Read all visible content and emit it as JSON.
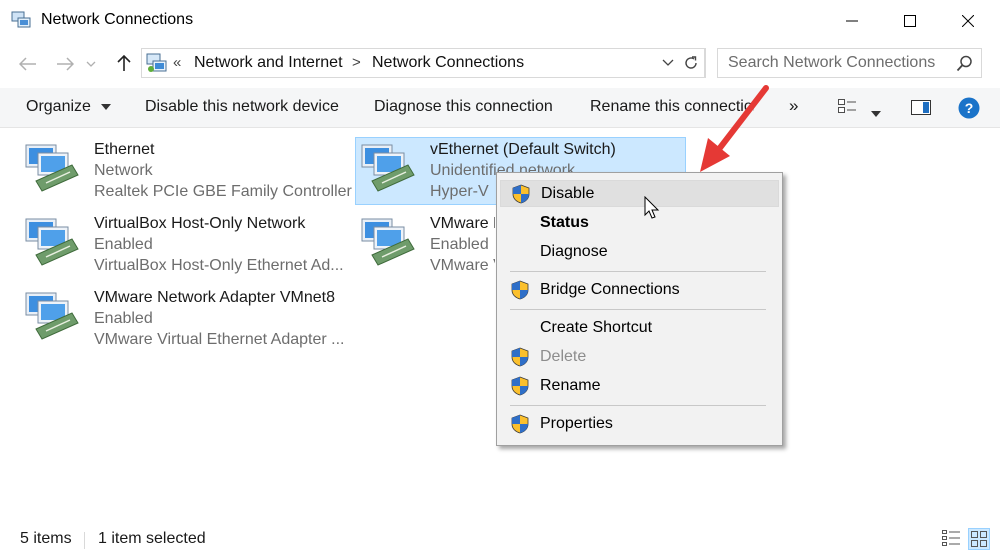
{
  "window": {
    "title": "Network Connections"
  },
  "address": {
    "overflow": "«",
    "crumbs": [
      "Network and Internet",
      "Network Connections"
    ],
    "separator": ">"
  },
  "search": {
    "placeholder": "Search Network Connections"
  },
  "toolbar": {
    "organize": "Organize",
    "disable": "Disable this network device",
    "diagnose": "Diagnose this connection",
    "rename": "Rename this connection",
    "more": "»"
  },
  "items": [
    {
      "name": "Ethernet",
      "status": "Network",
      "device": "Realtek PCIe GBE Family Controller"
    },
    {
      "name": "VirtualBox Host-Only Network",
      "status": "Enabled",
      "device": "VirtualBox Host-Only Ethernet Ad..."
    },
    {
      "name": "VMware Network Adapter VMnet8",
      "status": "Enabled",
      "device": "VMware Virtual Ethernet Adapter ..."
    },
    {
      "name": "vEthernet (Default Switch)",
      "status": "Unidentified network",
      "device": "Hyper-V"
    },
    {
      "name": "VMware N",
      "status": "Enabled",
      "device": "VMware V"
    }
  ],
  "context_menu": {
    "items": [
      {
        "label": "Disable",
        "shield": true
      },
      {
        "label": "Status",
        "shield": false
      },
      {
        "label": "Diagnose",
        "shield": false
      },
      {
        "label": "Bridge Connections",
        "shield": true
      },
      {
        "label": "Create Shortcut",
        "shield": false
      },
      {
        "label": "Delete",
        "shield": true
      },
      {
        "label": "Rename",
        "shield": true
      },
      {
        "label": "Properties",
        "shield": true
      }
    ]
  },
  "status_bar": {
    "count": "5 items",
    "selection": "1 item selected"
  },
  "colors": {
    "selection_bg": "#cce8ff",
    "arrow": "#e53935",
    "help": "#1a73c9"
  },
  "icons": {
    "app": "network-connections-icon",
    "adapter": "network-adapter-icon",
    "shield": "uac-shield-icon"
  }
}
